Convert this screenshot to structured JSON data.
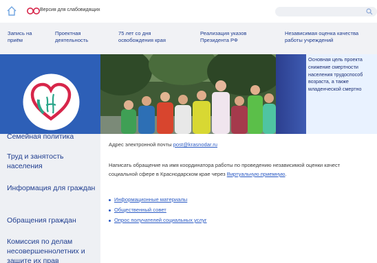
{
  "topbar": {
    "vision_label": "Версия для слабовидящих",
    "search_placeholder": ""
  },
  "nav": {
    "items": [
      {
        "label": "Запись на\nприём"
      },
      {
        "label": "Проектная\nдеятельность"
      },
      {
        "label": "75 лет со дня\nосвобождения края"
      },
      {
        "label": "Реализация указов\nПрезидента РФ"
      },
      {
        "label": "Независимая оценка качества\nработы учреждений"
      }
    ]
  },
  "banner": {
    "screen_text": "Основная цель проекта\nснижение смертности\nнаселения трудоспособ\nвозраста, а также\nмладенческой смертно"
  },
  "sidebar": {
    "items": [
      {
        "label": "Семейная политика"
      },
      {
        "label": "Труд и занятость населения"
      },
      {
        "label": "Информация для граждан"
      },
      {
        "label": "Обращения граждан"
      },
      {
        "label": "Комиссия по делам несовершеннолетних и защите их прав"
      }
    ]
  },
  "content": {
    "email_prefix": "Адрес электронной почты ",
    "email": "post@krasnodar.ru",
    "appeal_line1": "Написать обращение на имя координатора работы по проведению независимой оценки качест",
    "appeal_line2_prefix": "социальной сфере в Краснодарском крае через ",
    "appeal_link": "Виртуальную приемную",
    "appeal_line2_suffix": ".",
    "links": [
      {
        "label": "Информационные материалы"
      },
      {
        "label": "Общественный совет"
      },
      {
        "label": "Опрос получателей социальных услуг"
      }
    ]
  },
  "colors": {
    "nav_text": "#1d3b8f",
    "link": "#2a5ac4",
    "sidebar_bg": "#eef0f4",
    "brand_blue": "#2d5fb7",
    "logo_heart_red": "#d7264a",
    "logo_heart_green": "#2aa68a"
  }
}
